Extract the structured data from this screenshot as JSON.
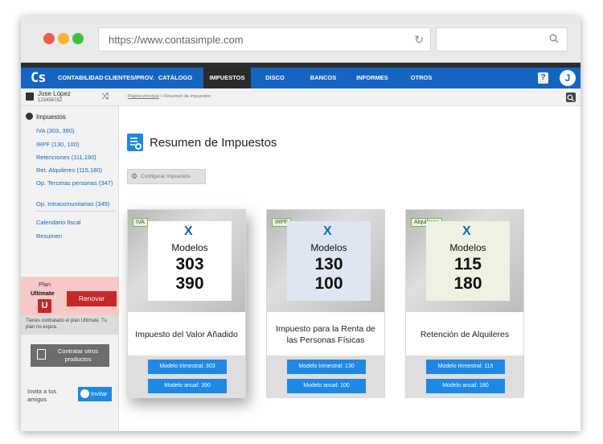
{
  "browser": {
    "url": "https://www.contasimple.com"
  },
  "nav": {
    "logo": "Cs",
    "items": [
      {
        "label": "CONTABILIDAD"
      },
      {
        "label": "CLIENTES/PROV."
      },
      {
        "label": "CATÁLOGO"
      },
      {
        "label": "IMPUESTOS",
        "active": true
      },
      {
        "label": "DISCO VIRTUAL"
      },
      {
        "label": "BANCOS"
      },
      {
        "label": "INFORMES"
      },
      {
        "label": "OTROS"
      }
    ],
    "help_label": "?",
    "avatar_initial": "J",
    "accent_color": "#1565c0"
  },
  "user": {
    "name": "Jose López",
    "id": "12345678Z"
  },
  "breadcrumb": {
    "prefix": "::",
    "home": "Página principal",
    "separator": ">",
    "current": "Resumen de impuestos"
  },
  "sidebar": {
    "section_title": "Impuestos",
    "items": [
      {
        "label": "IVA (303, 390)"
      },
      {
        "label": "IRPF (130, 100)"
      },
      {
        "label": "Retenciones (111,190)"
      },
      {
        "label": "Ret. Alquileres (115,180)"
      },
      {
        "label": "Op. Terceras personas (347)"
      },
      {
        "label": "Op. Intracomunitarias (349)"
      },
      {
        "label": "Calendario fiscal"
      },
      {
        "label": "Resumen"
      }
    ],
    "plan": {
      "label": "Plan",
      "name": "Ultimate",
      "badge": "U",
      "renew_label": "Renovar",
      "info": "Tienes contratado el plan Ultimate. Tu plan no expira."
    },
    "contract_label": "Contratar otros productos",
    "invite_text": "Invita a tus amigos",
    "invite_button": "Invitar"
  },
  "main": {
    "title": "Resumen de Impuestos",
    "config_button": "Configurar impuestos",
    "cards": [
      {
        "tag": "IVA",
        "logo": "X",
        "models_label": "Modelos",
        "model_a": "303",
        "model_b": "390",
        "name": "Impuesto del Valor Añadido",
        "panel_color": "#ffffff",
        "btn_quarterly": "Modelo trimestral: 303",
        "btn_annual": "Modelo anual: 390"
      },
      {
        "tag": "IRPF",
        "logo": "X",
        "models_label": "Modelos",
        "model_a": "130",
        "model_b": "100",
        "name": "Impuesto para la Renta de las Personas Físicas",
        "panel_color": "#dfe6f2",
        "btn_quarterly": "Modelo trimestral: 130",
        "btn_annual": "Modelo anual: 100"
      },
      {
        "tag": "Alquileres",
        "logo": "X",
        "models_label": "Modelos",
        "model_a": "115",
        "model_b": "180",
        "name": "Retención de Alquileres",
        "panel_color": "#eef2e2",
        "btn_quarterly": "Modelo trimestral: 115",
        "btn_annual": "Modelo anual: 180"
      }
    ]
  }
}
